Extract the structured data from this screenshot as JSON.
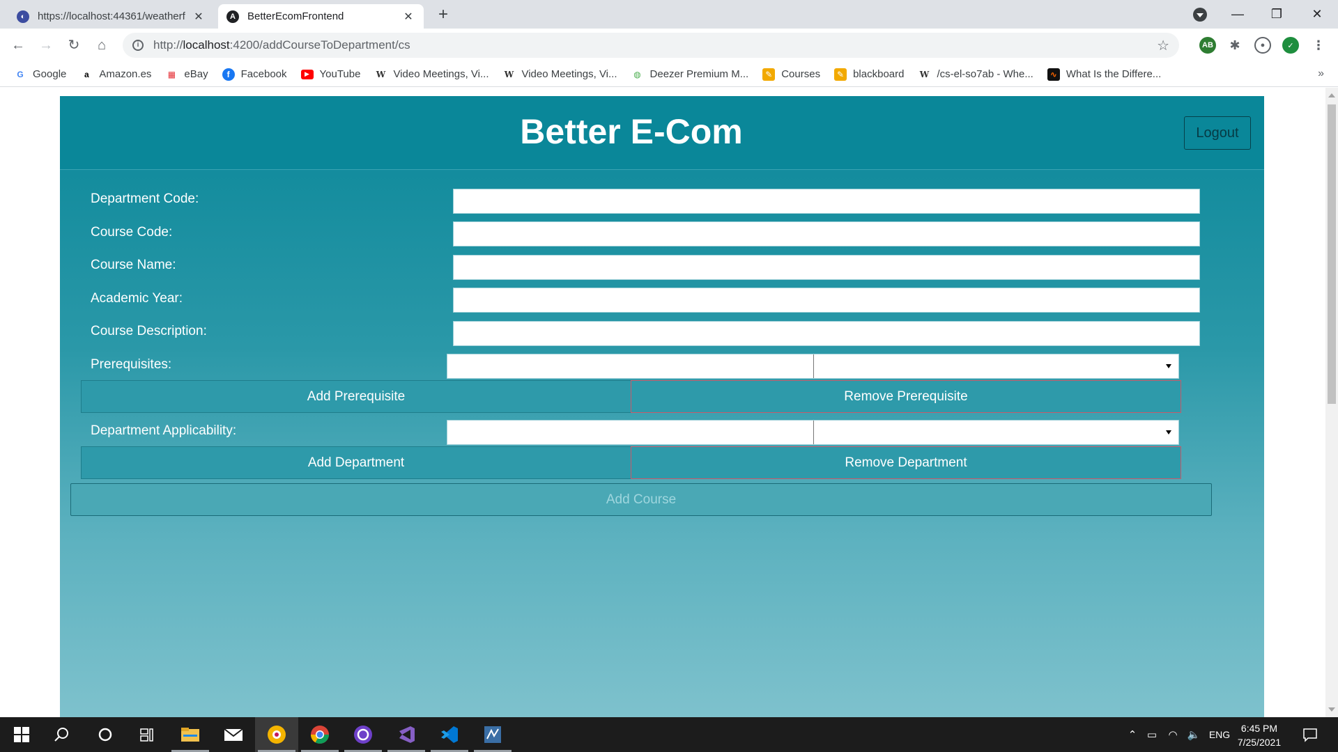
{
  "browser": {
    "tabs": [
      {
        "title": "https://localhost:44361/weatherf",
        "active": false
      },
      {
        "title": "BetterEcomFrontend",
        "active": true
      }
    ],
    "new_tab_symbol": "+",
    "url": {
      "prefix": "http://",
      "host": "localhost",
      "path": ":4200/addCourseToDepartment/cs"
    },
    "bookmarks": [
      {
        "label": "Google",
        "icon": "google-icon",
        "color": "#4285f4",
        "glyph": "G"
      },
      {
        "label": "Amazon.es",
        "icon": "amazon-icon",
        "color": "#000000",
        "glyph": "a"
      },
      {
        "label": "eBay",
        "icon": "ebay-icon",
        "color": "#e53238",
        "glyph": "▦"
      },
      {
        "label": "Facebook",
        "icon": "facebook-icon",
        "color": "#1877f2",
        "glyph": "f"
      },
      {
        "label": "YouTube",
        "icon": "youtube-icon",
        "color": "#ff0000",
        "glyph": "▶"
      },
      {
        "label": "Video Meetings, Vi...",
        "icon": "w-icon",
        "color": "#333333",
        "glyph": "W"
      },
      {
        "label": "Video Meetings, Vi...",
        "icon": "w-icon",
        "color": "#333333",
        "glyph": "W"
      },
      {
        "label": "Deezer Premium M...",
        "icon": "deezer-icon",
        "color": "#4caf50",
        "glyph": "◍"
      },
      {
        "label": "Courses",
        "icon": "courses-icon",
        "color": "#f2a900",
        "glyph": "✎"
      },
      {
        "label": "blackboard",
        "icon": "blackboard-icon",
        "color": "#f2a900",
        "glyph": "✎"
      },
      {
        "label": "/cs-el-so7ab - Whe...",
        "icon": "w-icon",
        "color": "#333333",
        "glyph": "W"
      },
      {
        "label": "What Is the Differe...",
        "icon": "wave-icon",
        "color": "#111111",
        "glyph": "∿"
      }
    ],
    "bookmarks_overflow": "»"
  },
  "app": {
    "brand": "Better E-Com",
    "logout_label": "Logout",
    "form": {
      "department_code_label": "Department Code:",
      "department_code_value": "",
      "course_code_label": "Course Code:",
      "course_code_value": "",
      "course_name_label": "Course Name:",
      "course_name_value": "",
      "academic_year_label": "Academic Year:",
      "academic_year_value": "",
      "course_description_label": "Course Description:",
      "course_description_value": "",
      "prerequisites_label": "Prerequisites:",
      "add_prerequisite_label": "Add Prerequisite",
      "remove_prerequisite_label": "Remove Prerequisite",
      "department_applicability_label": "Department Applicability:",
      "add_department_label": "Add Department",
      "remove_department_label": "Remove Department",
      "add_course_label": "Add Course"
    },
    "colors": {
      "header": "#0a8799",
      "button": "#2e9aaa"
    }
  },
  "taskbar": {
    "apps": [
      "windows-start-icon",
      "search-icon",
      "cortana-icon",
      "task-view-icon",
      "file-explorer-icon",
      "mail-icon",
      "brave-icon",
      "chrome-icon",
      "github-desktop-icon",
      "visual-studio-icon",
      "vscode-icon",
      "sql-server-icon"
    ],
    "language": "ENG",
    "time": "6:45 PM",
    "date": "7/25/2021"
  }
}
